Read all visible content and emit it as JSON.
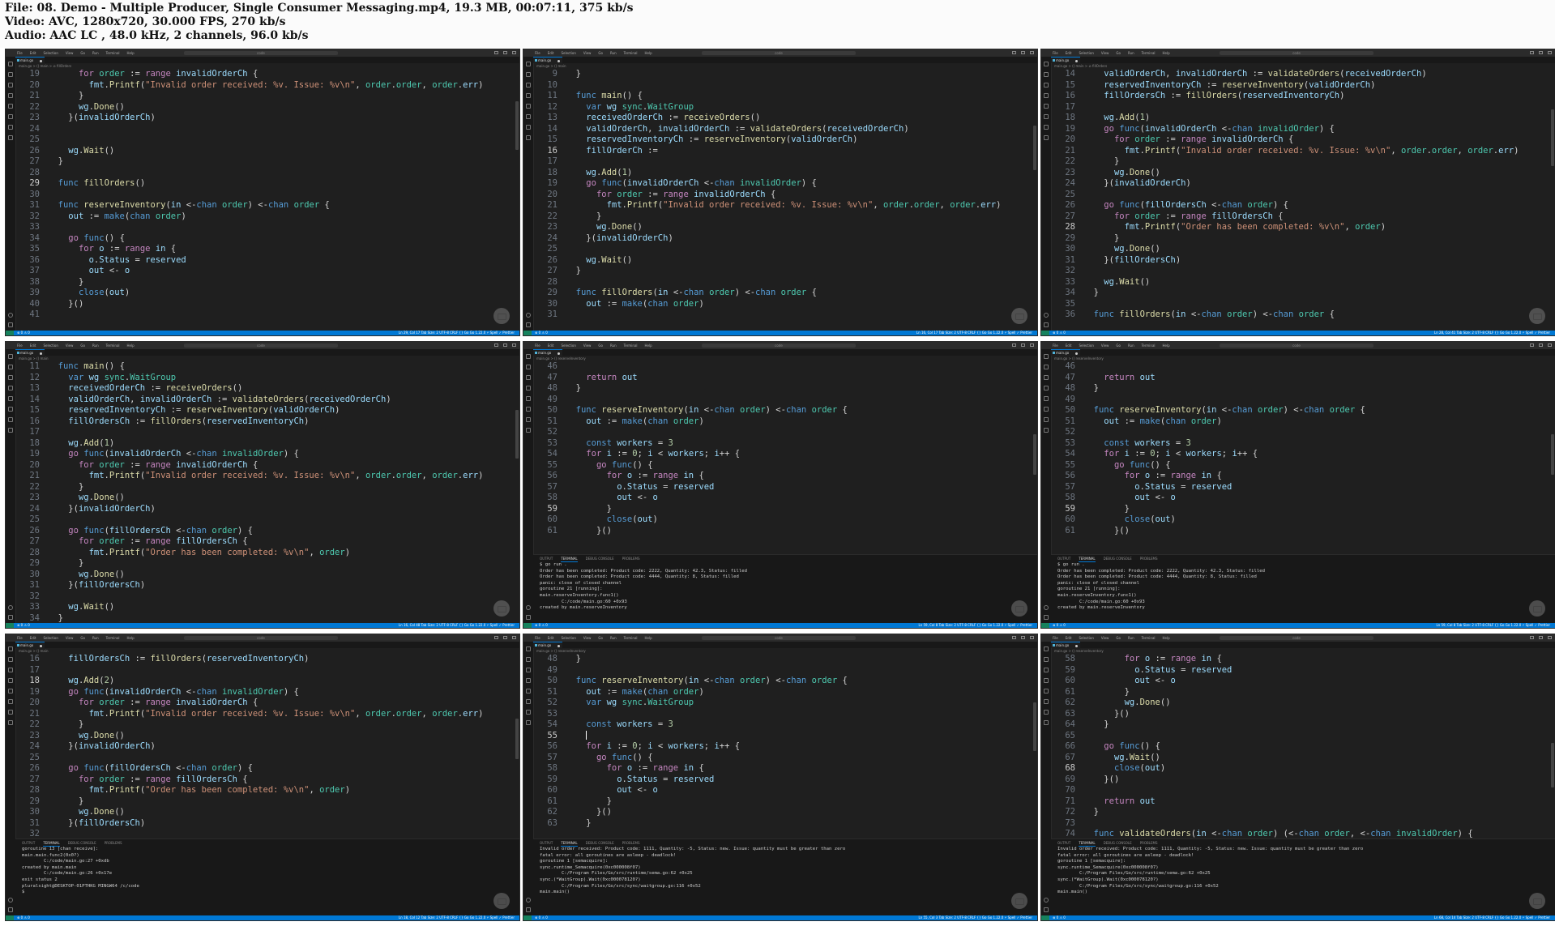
{
  "header": {
    "file_line": "File: 08. Demo - Multiple Producer, Single Consumer Messaging.mp4, 19.3 MB, 00:07:11, 375 kb/s",
    "video_line": "Video: AVC, 1280x720, 30.000 FPS, 270 kb/s",
    "audio_line": "Audio: AAC LC , 48.0 kHz, 2 channels, 96.0 kb/s"
  },
  "frames": [
    {
      "tab": "main.go",
      "breadcrumb": "main.go > () main > ⊘ fillOrders",
      "status_left": "⊗ 0 ⚠ 0",
      "status_right": "Ln 29, Col 17   Tab Size: 2   UTF-8   CRLF   {} Go   Go 1.22.0   ⚡ Spell   ✓ Prettier",
      "lines": [
        {
          "n": "19",
          "t": "      for order := range invalidOrderCh {"
        },
        {
          "n": "20",
          "t": "        fmt.Printf(\"Invalid order received: %v. Issue: %v\\n\", order.order, order.err)"
        },
        {
          "n": "21",
          "t": "      }"
        },
        {
          "n": "22",
          "t": "      wg.Done()"
        },
        {
          "n": "23",
          "t": "    }(invalidOrderCh)"
        },
        {
          "n": "24",
          "t": ""
        },
        {
          "n": "25",
          "t": ""
        },
        {
          "n": "26",
          "t": "    wg.Wait()"
        },
        {
          "n": "27",
          "t": "  }"
        },
        {
          "n": "28",
          "t": ""
        },
        {
          "n": "29",
          "t": "  func fillOrders()",
          "cur": true
        },
        {
          "n": "30",
          "t": ""
        },
        {
          "n": "31",
          "t": "  func reserveInventory(in <-chan order) <-chan order {"
        },
        {
          "n": "32",
          "t": "    out := make(chan order)"
        },
        {
          "n": "33",
          "t": ""
        },
        {
          "n": "34",
          "t": "    go func() {"
        },
        {
          "n": "35",
          "t": "      for o := range in {"
        },
        {
          "n": "36",
          "t": "        o.Status = reserved"
        },
        {
          "n": "37",
          "t": "        out <- o"
        },
        {
          "n": "38",
          "t": "      }"
        },
        {
          "n": "39",
          "t": "      close(out)"
        },
        {
          "n": "40",
          "t": "    }()"
        },
        {
          "n": "41",
          "t": ""
        }
      ],
      "terminal": []
    },
    {
      "tab": "main.go",
      "breadcrumb": "main.go > () main",
      "status_left": "⊗ 0 ⚠ 0",
      "status_right": "Ln 16, Col 17   Tab Size: 2   UTF-8   CRLF   {} Go   Go 1.22.0   ⚡ Spell   ✓ Prettier",
      "lines": [
        {
          "n": "9",
          "t": "  }"
        },
        {
          "n": "10",
          "t": ""
        },
        {
          "n": "11",
          "t": "  func main() {"
        },
        {
          "n": "12",
          "t": "    var wg sync.WaitGroup"
        },
        {
          "n": "13",
          "t": "    receivedOrderCh := receiveOrders()"
        },
        {
          "n": "14",
          "t": "    validOrderCh, invalidOrderCh := validateOrders(receivedOrderCh)"
        },
        {
          "n": "15",
          "t": "    reservedInventoryCh := reserveInventory(validOrderCh)"
        },
        {
          "n": "16",
          "t": "    fillOrderCh :=",
          "cur": true
        },
        {
          "n": "17",
          "t": ""
        },
        {
          "n": "18",
          "t": "    wg.Add(1)"
        },
        {
          "n": "19",
          "t": "    go func(invalidOrderCh <-chan invalidOrder) {"
        },
        {
          "n": "20",
          "t": "      for order := range invalidOrderCh {"
        },
        {
          "n": "21",
          "t": "        fmt.Printf(\"Invalid order received: %v. Issue: %v\\n\", order.order, order.err)"
        },
        {
          "n": "22",
          "t": "      }"
        },
        {
          "n": "23",
          "t": "      wg.Done()"
        },
        {
          "n": "24",
          "t": "    }(invalidOrderCh)"
        },
        {
          "n": "25",
          "t": ""
        },
        {
          "n": "26",
          "t": "    wg.Wait()"
        },
        {
          "n": "27",
          "t": "  }"
        },
        {
          "n": "28",
          "t": ""
        },
        {
          "n": "29",
          "t": "  func fillOrders(in <-chan order) <-chan order {"
        },
        {
          "n": "30",
          "t": "    out := make(chan order)"
        },
        {
          "n": "31",
          "t": ""
        }
      ],
      "terminal": []
    },
    {
      "tab": "main.go",
      "breadcrumb": "main.go > () main > ⊘ fillOrders",
      "status_left": "⊗ 0 ⚠ 0",
      "status_right": "Ln 28, Col 41   Tab Size: 2   UTF-8   CRLF   {} Go   Go 1.22.0   ⚡ Spell   ✓ Prettier",
      "lines": [
        {
          "n": "14",
          "t": "    validOrderCh, invalidOrderCh := validateOrders(receivedOrderCh)"
        },
        {
          "n": "15",
          "t": "    reservedInventoryCh := reserveInventory(validOrderCh)"
        },
        {
          "n": "16",
          "t": "    fillOrdersCh := fillOrders(reservedInventoryCh)"
        },
        {
          "n": "17",
          "t": ""
        },
        {
          "n": "18",
          "t": "    wg.Add(1)"
        },
        {
          "n": "19",
          "t": "    go func(invalidOrderCh <-chan invalidOrder) {"
        },
        {
          "n": "20",
          "t": "      for order := range invalidOrderCh {"
        },
        {
          "n": "21",
          "t": "        fmt.Printf(\"Invalid order received: %v. Issue: %v\\n\", order.order, order.err)"
        },
        {
          "n": "22",
          "t": "      }"
        },
        {
          "n": "23",
          "t": "      wg.Done()"
        },
        {
          "n": "24",
          "t": "    }(invalidOrderCh)"
        },
        {
          "n": "25",
          "t": ""
        },
        {
          "n": "26",
          "t": "    go func(fillOrdersCh <-chan order) {"
        },
        {
          "n": "27",
          "t": "      for order := range fillOrdersCh {"
        },
        {
          "n": "28",
          "t": "        fmt.Printf(\"Order has been completed: %v\\n\", order)",
          "cur": true
        },
        {
          "n": "29",
          "t": "      }"
        },
        {
          "n": "30",
          "t": "      wg.Done()"
        },
        {
          "n": "31",
          "t": "    }(fillOrdersCh)"
        },
        {
          "n": "32",
          "t": ""
        },
        {
          "n": "33",
          "t": "    wg.Wait()"
        },
        {
          "n": "34",
          "t": "  }"
        },
        {
          "n": "35",
          "t": ""
        },
        {
          "n": "36",
          "t": "  func fillOrders(in <-chan order) <-chan order {"
        }
      ],
      "terminal": []
    },
    {
      "tab": "main.go",
      "breadcrumb": "main.go > () main",
      "status_left": "⊗ 0 ⚠ 0",
      "status_right": "Ln 16, Col 48   Tab Size: 2   UTF-8   CRLF   {} Go   Go 1.22.0   ⚡ Spell   ✓ Prettier",
      "lines": [
        {
          "n": "11",
          "t": "  func main() {"
        },
        {
          "n": "12",
          "t": "    var wg sync.WaitGroup"
        },
        {
          "n": "13",
          "t": "    receivedOrderCh := receiveOrders()"
        },
        {
          "n": "14",
          "t": "    validOrderCh, invalidOrderCh := validateOrders(receivedOrderCh)"
        },
        {
          "n": "15",
          "t": "    reservedInventoryCh := reserveInventory(validOrderCh)"
        },
        {
          "n": "16",
          "t": "    fillOrdersCh := fillOrders(reservedInventoryCh)"
        },
        {
          "n": "17",
          "t": ""
        },
        {
          "n": "18",
          "t": "    wg.Add(1)"
        },
        {
          "n": "19",
          "t": "    go func(invalidOrderCh <-chan invalidOrder) {"
        },
        {
          "n": "20",
          "t": "      for order := range invalidOrderCh {"
        },
        {
          "n": "21",
          "t": "        fmt.Printf(\"Invalid order received: %v. Issue: %v\\n\", order.order, order.err)"
        },
        {
          "n": "22",
          "t": "      }"
        },
        {
          "n": "23",
          "t": "      wg.Done()"
        },
        {
          "n": "24",
          "t": "    }(invalidOrderCh)"
        },
        {
          "n": "25",
          "t": ""
        },
        {
          "n": "26",
          "t": "    go func(fillOrdersCh <-chan order) {"
        },
        {
          "n": "27",
          "t": "      for order := range fillOrdersCh {"
        },
        {
          "n": "28",
          "t": "        fmt.Printf(\"Order has been completed: %v\\n\", order)"
        },
        {
          "n": "29",
          "t": "      }"
        },
        {
          "n": "30",
          "t": "      wg.Done()"
        },
        {
          "n": "31",
          "t": "    }(fillOrdersCh)"
        },
        {
          "n": "32",
          "t": ""
        },
        {
          "n": "33",
          "t": "    wg.Wait()"
        },
        {
          "n": "34",
          "t": "  }"
        }
      ],
      "terminal": []
    },
    {
      "tab": "main.go",
      "breadcrumb": "main.go > () reserveInventory",
      "status_left": "⊗ 0 ⚠ 0",
      "status_right": "Ln 59, Col 8   Tab Size: 2   UTF-8   CRLF   {} Go   Go 1.22.0   ⚡ Spell   ✓ Prettier",
      "lines": [
        {
          "n": "46",
          "t": ""
        },
        {
          "n": "47",
          "t": "    return out"
        },
        {
          "n": "48",
          "t": "  }"
        },
        {
          "n": "49",
          "t": ""
        },
        {
          "n": "50",
          "t": "  func reserveInventory(in <-chan order) <-chan order {"
        },
        {
          "n": "51",
          "t": "    out := make(chan order)"
        },
        {
          "n": "52",
          "t": ""
        },
        {
          "n": "53",
          "t": "    const workers = 3"
        },
        {
          "n": "54",
          "t": "    for i := 0; i < workers; i++ {"
        },
        {
          "n": "55",
          "t": "      go func() {"
        },
        {
          "n": "56",
          "t": "        for o := range in {"
        },
        {
          "n": "57",
          "t": "          o.Status = reserved"
        },
        {
          "n": "58",
          "t": "          out <- o"
        },
        {
          "n": "59",
          "t": "        }",
          "cur": true
        },
        {
          "n": "60",
          "t": "        close(out)"
        },
        {
          "n": "61",
          "t": "      }()"
        }
      ],
      "terminal": [
        "$ go run .",
        "Order has been completed: Product code: 2222, Quantity: 42.3, Status: filled",
        "Order has been completed: Product code: 4444, Quantity: 8, Status: filled",
        "panic: close of closed channel",
        "",
        "goroutine 21 [running]:",
        "main.reserveInventory.func1()",
        "        C:/code/main.go:60 +0x93",
        "created by main.reserveInventory"
      ]
    },
    {
      "tab": "main.go",
      "breadcrumb": "main.go > () reserveInventory",
      "status_left": "⊗ 0 ⚠ 0",
      "status_right": "Ln 59, Col 8   Tab Size: 2   UTF-8   CRLF   {} Go   Go 1.22.0   ⚡ Spell   ✓ Prettier",
      "lines": [
        {
          "n": "46",
          "t": ""
        },
        {
          "n": "47",
          "t": "    return out"
        },
        {
          "n": "48",
          "t": "  }"
        },
        {
          "n": "49",
          "t": ""
        },
        {
          "n": "50",
          "t": "  func reserveInventory(in <-chan order) <-chan order {"
        },
        {
          "n": "51",
          "t": "    out := make(chan order)"
        },
        {
          "n": "52",
          "t": ""
        },
        {
          "n": "53",
          "t": "    const workers = 3"
        },
        {
          "n": "54",
          "t": "    for i := 0; i < workers; i++ {"
        },
        {
          "n": "55",
          "t": "      go func() {"
        },
        {
          "n": "56",
          "t": "        for o := range in {"
        },
        {
          "n": "57",
          "t": "          o.Status = reserved"
        },
        {
          "n": "58",
          "t": "          out <- o"
        },
        {
          "n": "59",
          "t": "        }",
          "cur": true
        },
        {
          "n": "60",
          "t": "        close(out)"
        },
        {
          "n": "61",
          "t": "      }()"
        }
      ],
      "terminal": [
        "$ go run .",
        "Order has been completed: Product code: 2222, Quantity: 42.3, Status: filled",
        "Order has been completed: Product code: 4444, Quantity: 8, Status: filled",
        "panic: close of closed channel",
        "",
        "goroutine 21 [running]:",
        "main.reserveInventory.func1()",
        "        C:/code/main.go:60 +0x93",
        "created by main.reserveInventory"
      ]
    },
    {
      "tab": "main.go",
      "breadcrumb": "main.go > () main",
      "status_left": "⊗ 0 ⚠ 0",
      "status_right": "Ln 18, Col 12   Tab Size: 2   UTF-8   CRLF   {} Go   Go 1.22.0   ⚡ Spell   ✓ Prettier",
      "lines": [
        {
          "n": "16",
          "t": "    fillOrdersCh := fillOrders(reservedInventoryCh)"
        },
        {
          "n": "17",
          "t": ""
        },
        {
          "n": "18",
          "t": "    wg.Add(2)",
          "cur": true
        },
        {
          "n": "19",
          "t": "    go func(invalidOrderCh <-chan invalidOrder) {"
        },
        {
          "n": "20",
          "t": "      for order := range invalidOrderCh {"
        },
        {
          "n": "21",
          "t": "        fmt.Printf(\"Invalid order received: %v. Issue: %v\\n\", order.order, order.err)"
        },
        {
          "n": "22",
          "t": "      }"
        },
        {
          "n": "23",
          "t": "      wg.Done()"
        },
        {
          "n": "24",
          "t": "    }(invalidOrderCh)"
        },
        {
          "n": "25",
          "t": ""
        },
        {
          "n": "26",
          "t": "    go func(fillOrdersCh <-chan order) {"
        },
        {
          "n": "27",
          "t": "      for order := range fillOrdersCh {"
        },
        {
          "n": "28",
          "t": "        fmt.Printf(\"Order has been completed: %v\\n\", order)"
        },
        {
          "n": "29",
          "t": "      }"
        },
        {
          "n": "30",
          "t": "      wg.Done()"
        },
        {
          "n": "31",
          "t": "    }(fillOrdersCh)"
        },
        {
          "n": "32",
          "t": ""
        }
      ],
      "terminal": [
        "goroutine 13 [chan receive]:",
        "main.main.func2(0x0?)",
        "        C:/code/main.go:27 +0xdb",
        "created by main.main",
        "        C:/code/main.go:26 +0x17e",
        "exit status 2",
        "",
        "pluralsight@DESKTOP-01PTHKG MINGW64 /c/code",
        "$"
      ]
    },
    {
      "tab": "main.go",
      "breadcrumb": "main.go > () reserveInventory",
      "status_left": "⊗ 0 ⚠ 0",
      "status_right": "Ln 55, Col 3   Tab Size: 2   UTF-8   CRLF   {} Go   Go 1.22.0   ⚡ Spell   ✓ Prettier",
      "lines": [
        {
          "n": "48",
          "t": "  }"
        },
        {
          "n": "49",
          "t": ""
        },
        {
          "n": "50",
          "t": "  func reserveInventory(in <-chan order) <-chan order {"
        },
        {
          "n": "51",
          "t": "    out := make(chan order)"
        },
        {
          "n": "52",
          "t": "    var wg sync.WaitGroup"
        },
        {
          "n": "53",
          "t": ""
        },
        {
          "n": "54",
          "t": "    const workers = 3"
        },
        {
          "n": "55",
          "t": "    |",
          "cur": true
        },
        {
          "n": "56",
          "t": "    for i := 0; i < workers; i++ {"
        },
        {
          "n": "57",
          "t": "      go func() {"
        },
        {
          "n": "58",
          "t": "        for o := range in {"
        },
        {
          "n": "59",
          "t": "          o.Status = reserved"
        },
        {
          "n": "60",
          "t": "          out <- o"
        },
        {
          "n": "61",
          "t": "        }"
        },
        {
          "n": "62",
          "t": "      }()"
        },
        {
          "n": "63",
          "t": "    }"
        }
      ],
      "terminal": [
        "Invalid order received: Product code: 1111, Quantity: -5, Status: new. Issue: quantity must be greater than zero",
        "fatal error: all goroutines are asleep - deadlock!",
        "",
        "goroutine 1 [semacquire]:",
        "sync.runtime_Semacquire(0xc000008f07)",
        "        C:/Program Files/Go/src/runtime/sema.go:62 +0x25",
        "sync.(*WaitGroup).Wait(0xc000078120?)",
        "        C:/Program Files/Go/src/sync/waitgroup.go:116 +0x52",
        "main.main()"
      ]
    },
    {
      "tab": "main.go",
      "breadcrumb": "main.go > () reserveInventory",
      "status_left": "⊗ 0 ⚠ 0",
      "status_right": "Ln 68, Col 14   Tab Size: 2   UTF-8   CRLF   {} Go   Go 1.22.0   ⚡ Spell   ✓ Prettier",
      "lines": [
        {
          "n": "58",
          "t": "        for o := range in {"
        },
        {
          "n": "59",
          "t": "          o.Status = reserved"
        },
        {
          "n": "60",
          "t": "          out <- o"
        },
        {
          "n": "61",
          "t": "        }"
        },
        {
          "n": "62",
          "t": "        wg.Done()"
        },
        {
          "n": "63",
          "t": "      }()"
        },
        {
          "n": "64",
          "t": "    }"
        },
        {
          "n": "65",
          "t": ""
        },
        {
          "n": "66",
          "t": "    go func() {"
        },
        {
          "n": "67",
          "t": "      wg.Wait()"
        },
        {
          "n": "68",
          "t": "      close(out)",
          "cur": true
        },
        {
          "n": "69",
          "t": "    }()"
        },
        {
          "n": "70",
          "t": ""
        },
        {
          "n": "71",
          "t": "    return out"
        },
        {
          "n": "72",
          "t": "  }"
        },
        {
          "n": "73",
          "t": ""
        },
        {
          "n": "74",
          "t": "  func validateOrders(in <-chan order) (<-chan order, <-chan invalidOrder) {"
        }
      ],
      "terminal": [
        "Invalid order received: Product code: 1111, Quantity: -5, Status: new. Issue: quantity must be greater than zero",
        "fatal error: all goroutines are asleep - deadlock!",
        "",
        "goroutine 1 [semacquire]:",
        "sync.runtime_Semacquire(0xc000008f07)",
        "        C:/Program Files/Go/src/runtime/sema.go:62 +0x25",
        "sync.(*WaitGroup).Wait(0xc000078120?)",
        "        C:/Program Files/Go/src/sync/waitgroup.go:116 +0x52",
        "main.main()"
      ]
    }
  ],
  "menu": [
    "File",
    "Edit",
    "Selection",
    "View",
    "Go",
    "Run",
    "Terminal",
    "Help"
  ],
  "command_center": "code",
  "panel_tabs": [
    "OUTPUT",
    "TERMINAL",
    "DEBUG CONSOLE",
    "PROBLEMS"
  ],
  "colors": {
    "editor_bg": "#1f1f1f",
    "status_bar": "#0078d4",
    "keyword": "#569cd6",
    "control": "#c586c0",
    "function": "#dcdcaa",
    "type": "#4ec9b0",
    "string": "#ce9178",
    "number": "#b5cea8",
    "variable": "#9cdcfe"
  }
}
